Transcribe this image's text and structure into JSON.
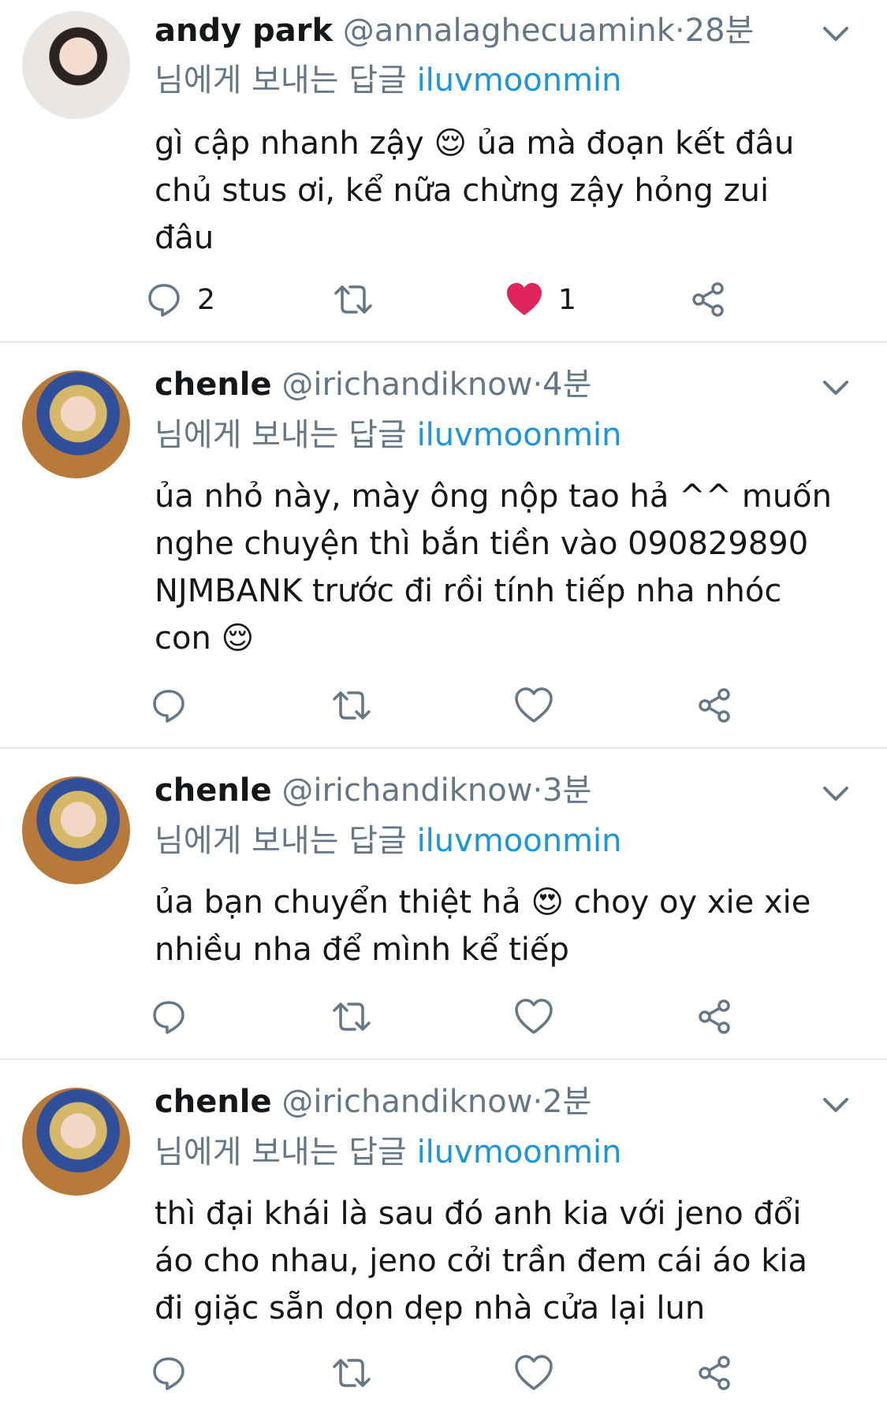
{
  "tweets": [
    {
      "name": "andy park",
      "handle": "@annalaghecuamink",
      "time": "28분",
      "reply_prefix": "님에게 보내는 답글",
      "reply_to": "iluvmoonmin",
      "text": "gì cập nhanh zậy 😌 ủa mà đoạn kết đâu\nchủ stus ơi, kể nữa chừng zậy hỏng zui\nđâu",
      "reply_count": "2",
      "like_count": "1",
      "liked": true
    },
    {
      "name": "chenle",
      "handle": "@irichandiknow",
      "time": "4분",
      "reply_prefix": "님에게 보내는 답글",
      "reply_to": "iluvmoonmin",
      "text": "ủa nhỏ này, mày ông nộp tao hả ^^ muốn\nnghe chuyện thì bắn tiền vào 090829890\nNJMBANK trước đi rồi tính tiếp nha nhóc\ncon 😌",
      "liked": false
    },
    {
      "name": "chenle",
      "handle": "@irichandiknow",
      "time": "3분",
      "reply_prefix": "님에게 보내는 답글",
      "reply_to": "iluvmoonmin",
      "text": "ủa bạn chuyển thiệt hả 😍 choy oy xie xie\nnhiều nha để mình kể tiếp",
      "liked": false
    },
    {
      "name": "chenle",
      "handle": "@irichandiknow",
      "time": "2분",
      "reply_prefix": "님에게 보내는 답글",
      "reply_to": "iluvmoonmin",
      "text": "thì đại khái là sau đó anh kia với jeno đổi\náo cho nhau, jeno cởi trần đem cái áo kia\nđi giặc sẵn dọn dẹp nhà cửa lại lun",
      "liked": false
    }
  ],
  "colors": {
    "link": "#1b95e0",
    "secondary": "#657786",
    "like": "#e0245e",
    "icon": "#657786",
    "divider": "#e1e8ed"
  },
  "icons": [
    "reply-icon",
    "retweet-icon",
    "heart-icon",
    "share-icon",
    "chevron-down-icon"
  ]
}
